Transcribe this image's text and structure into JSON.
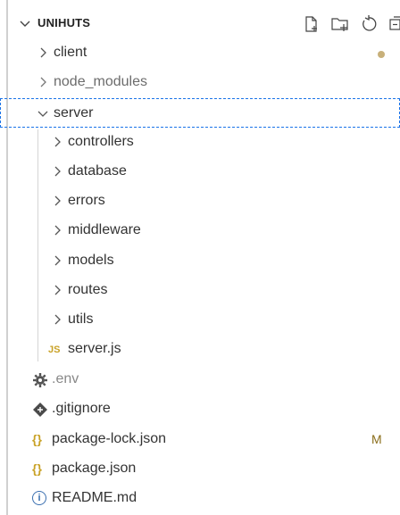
{
  "explorer": {
    "title": "UNIHUTS",
    "actions": [
      {
        "name": "new-file-icon"
      },
      {
        "name": "new-folder-icon"
      },
      {
        "name": "refresh-icon"
      },
      {
        "name": "collapse-all-icon"
      }
    ],
    "items": [
      {
        "label": "client",
        "type": "folder",
        "expanded": false,
        "status": "dot"
      },
      {
        "label": "node_modules",
        "type": "folder",
        "expanded": false
      },
      {
        "label": "server",
        "type": "folder",
        "expanded": true,
        "selected": true
      },
      {
        "label": "controllers",
        "type": "folder",
        "expanded": false
      },
      {
        "label": "database",
        "type": "folder",
        "expanded": false
      },
      {
        "label": "errors",
        "type": "folder",
        "expanded": false
      },
      {
        "label": "middleware",
        "type": "folder",
        "expanded": false
      },
      {
        "label": "models",
        "type": "folder",
        "expanded": false
      },
      {
        "label": "routes",
        "type": "folder",
        "expanded": false
      },
      {
        "label": "utils",
        "type": "folder",
        "expanded": false
      },
      {
        "label": "server.js",
        "type": "file",
        "icon": "js-icon",
        "icon_text": "JS"
      },
      {
        "label": ".env",
        "type": "file",
        "icon": "gear-icon"
      },
      {
        "label": ".gitignore",
        "type": "file",
        "icon": "git-icon"
      },
      {
        "label": "package-lock.json",
        "type": "file",
        "icon": "json-icon",
        "icon_text": "{}",
        "status": "M"
      },
      {
        "label": "package.json",
        "type": "file",
        "icon": "json-icon",
        "icon_text": "{}"
      },
      {
        "label": "README.md",
        "type": "file",
        "icon": "info-icon",
        "icon_text": "i"
      }
    ]
  },
  "colors": {
    "selection_border": "#1a73e8",
    "json_icon": "#c9a227",
    "js_icon": "#c9a227",
    "modified_status": "#8a6d1a"
  }
}
